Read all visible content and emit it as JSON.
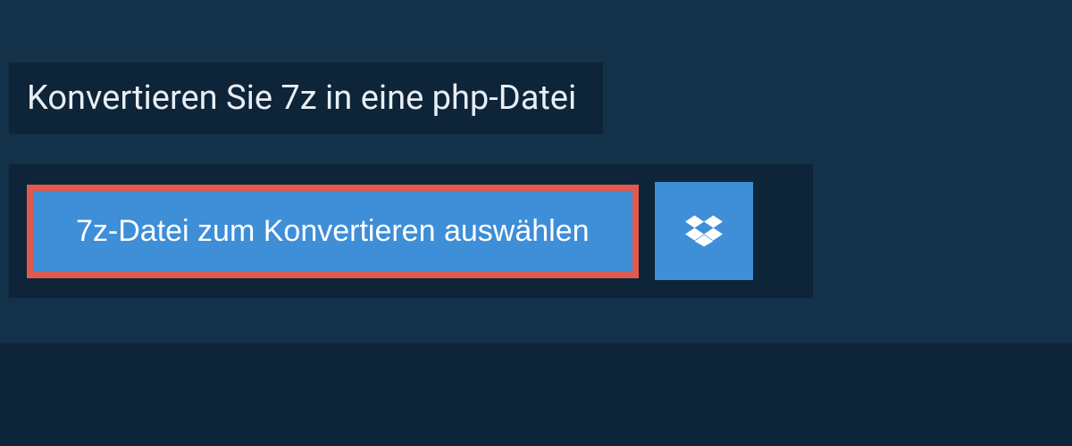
{
  "header": {
    "title": "Konvertieren Sie 7z in eine php-Datei"
  },
  "upload": {
    "select_button_label": "7z-Datei zum Konvertieren auswählen",
    "dropbox_icon_name": "dropbox-icon"
  },
  "colors": {
    "background": "#14314a",
    "panel": "#0e2438",
    "button_primary": "#3e8ed8",
    "highlight_border": "#e05a4e",
    "text_light": "#e8eef4",
    "text_white": "#ffffff"
  }
}
